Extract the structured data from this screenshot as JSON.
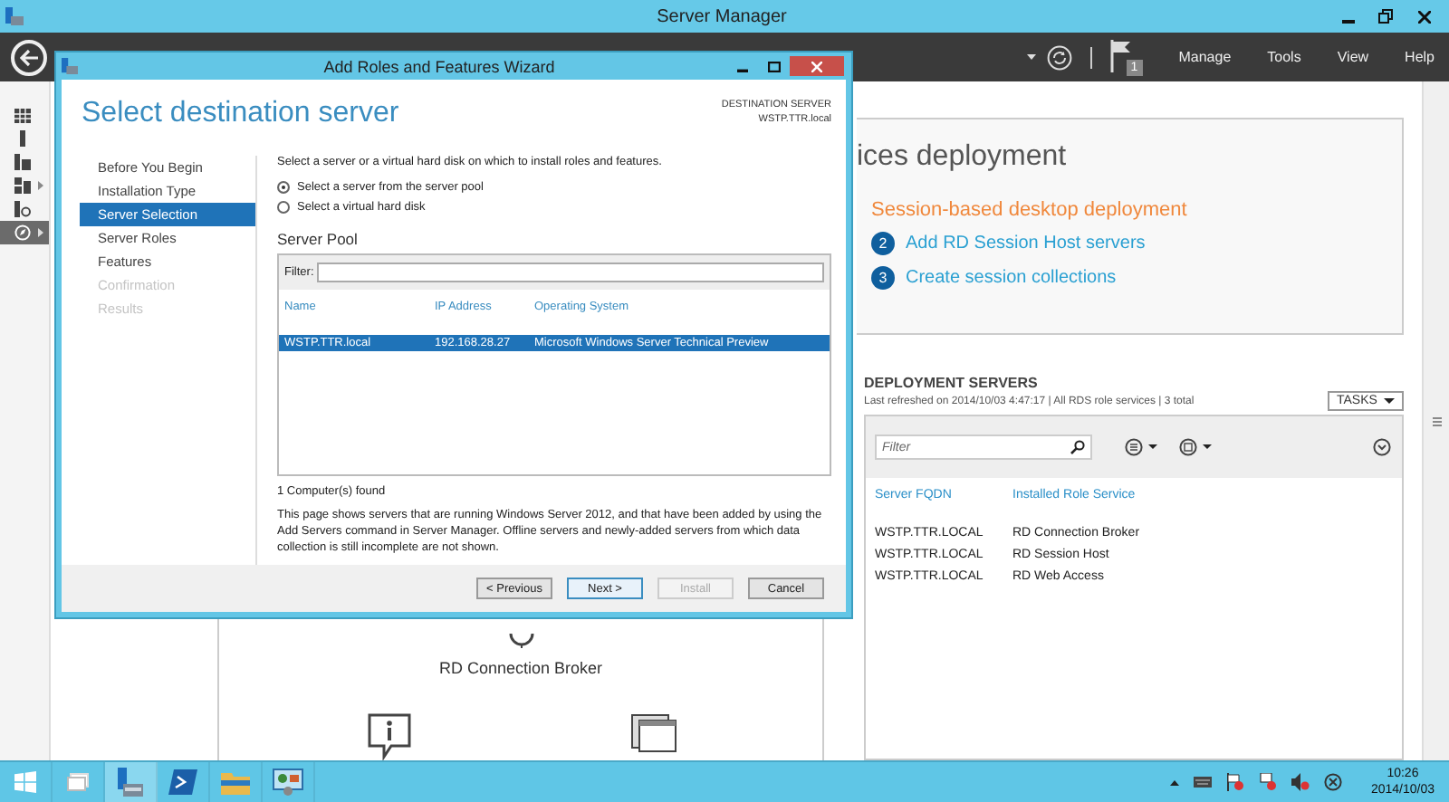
{
  "app": {
    "title": "Server Manager"
  },
  "nav": {
    "menus": [
      "Manage",
      "Tools",
      "View",
      "Help"
    ],
    "flag_count": "1"
  },
  "sidebar": {
    "items": [
      {
        "kind": "dashboard",
        "selected": false,
        "expandable": false
      },
      {
        "kind": "server",
        "selected": false,
        "expandable": false
      },
      {
        "kind": "servers",
        "selected": false,
        "expandable": false
      },
      {
        "kind": "storage",
        "selected": false,
        "expandable": true
      },
      {
        "kind": "web",
        "selected": false,
        "expandable": false
      },
      {
        "kind": "remote",
        "selected": true,
        "expandable": true
      }
    ]
  },
  "overview": {
    "title": "ices deployment",
    "subtitle": "Session-based desktop deployment",
    "steps": [
      {
        "number": "2",
        "label": "Add RD Session Host servers"
      },
      {
        "number": "3",
        "label": "Create session collections"
      }
    ]
  },
  "diagram": {
    "label": "RD Connection Broker"
  },
  "deployment_servers": {
    "title": "DEPLOYMENT SERVERS",
    "info": "Last refreshed on 2014/10/03 4:47:17 | All RDS role services  | 3 total",
    "tasks": "TASKS",
    "filter_placeholder": "Filter",
    "columns": [
      "Server FQDN",
      "Installed Role Service"
    ],
    "rows": [
      [
        "WSTP.TTR.LOCAL",
        "RD Connection Broker"
      ],
      [
        "WSTP.TTR.LOCAL",
        "RD Session Host"
      ],
      [
        "WSTP.TTR.LOCAL",
        "RD Web Access"
      ]
    ]
  },
  "wizard": {
    "title": "Add Roles and Features Wizard",
    "heading": "Select destination server",
    "destination_label": "DESTINATION SERVER",
    "destination_server": "WSTP.TTR.local",
    "steps": [
      {
        "label": "Before You Begin",
        "selected": false,
        "disabled": false
      },
      {
        "label": "Installation Type",
        "selected": false,
        "disabled": false
      },
      {
        "label": "Server Selection",
        "selected": true,
        "disabled": false
      },
      {
        "label": "Server Roles",
        "selected": false,
        "disabled": false
      },
      {
        "label": "Features",
        "selected": false,
        "disabled": false
      },
      {
        "label": "Confirmation",
        "selected": false,
        "disabled": true
      },
      {
        "label": "Results",
        "selected": false,
        "disabled": true
      }
    ],
    "instruction": "Select a server or a virtual hard disk on which to install roles and features.",
    "options": [
      {
        "label": "Select a server from the server pool",
        "selected": true
      },
      {
        "label": "Select a virtual hard disk",
        "selected": false
      }
    ],
    "pool_title": "Server Pool",
    "filter_label": "Filter:",
    "columns": [
      "Name",
      "IP Address",
      "Operating System"
    ],
    "rows": [
      {
        "cells": [
          "WSTP.TTR.local",
          "192.168.28.27",
          "Microsoft Windows Server Technical Preview"
        ],
        "selected": true
      }
    ],
    "found": "1 Computer(s) found",
    "note": "This page shows servers that are running Windows Server 2012, and that have been added by using the Add Servers command in Server Manager. Offline servers and newly-added servers from which data collection is still incomplete are not shown.",
    "buttons": [
      {
        "label": "< Previous",
        "disabled": false,
        "default": false
      },
      {
        "label": "Next >",
        "disabled": false,
        "default": true
      },
      {
        "label": "Install",
        "disabled": true,
        "default": false
      },
      {
        "label": "Cancel",
        "disabled": false,
        "default": false
      }
    ]
  },
  "taskbar": {
    "apps": [
      {
        "kind": "taskview",
        "selected": false
      },
      {
        "kind": "servermanager",
        "selected": true
      },
      {
        "kind": "powershell",
        "selected": false
      },
      {
        "kind": "explorer",
        "selected": false
      },
      {
        "kind": "controlpanel",
        "selected": false
      }
    ],
    "clock_time": "10:26",
    "clock_date": "2014/10/03"
  }
}
